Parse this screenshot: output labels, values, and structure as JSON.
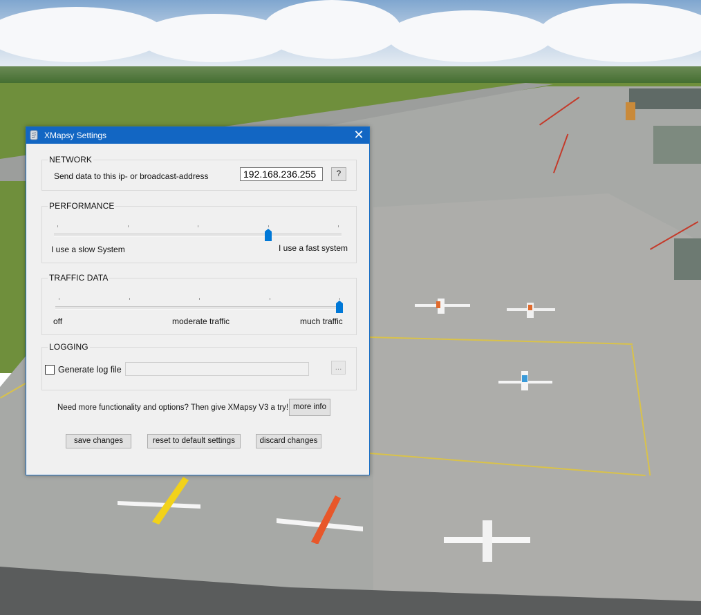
{
  "window": {
    "title": "XMapsy Settings",
    "close_label": "✕"
  },
  "network": {
    "group_label": "NETWORK",
    "ip_label": "Send data to this ip- or broadcast-address",
    "ip_value": "192.168.236.255",
    "help_label": "?"
  },
  "performance": {
    "group_label": "PERFORMANCE",
    "min_label": "I use a slow System",
    "max_label": "I use a fast system",
    "slider_level": 0.75
  },
  "traffic": {
    "group_label": "TRAFFIC DATA",
    "labels": [
      "off",
      "moderate traffic",
      "much traffic"
    ],
    "slider_level": 1.0
  },
  "logging": {
    "group_label": "LOGGING",
    "checkbox_label": "Generate log file",
    "checked": false,
    "path_value": "",
    "browse_label": "..."
  },
  "promo": {
    "text": "Need more functionality and options? Then give XMapsy V3 a try!",
    "more_info_label": "more info"
  },
  "actions": {
    "save_label": "save changes",
    "reset_label": "reset to default settings",
    "discard_label": "discard changes"
  },
  "colors": {
    "titlebar": "#1266c3",
    "slider_thumb": "#0078d7",
    "dialog_bg": "#f0f0f0"
  }
}
